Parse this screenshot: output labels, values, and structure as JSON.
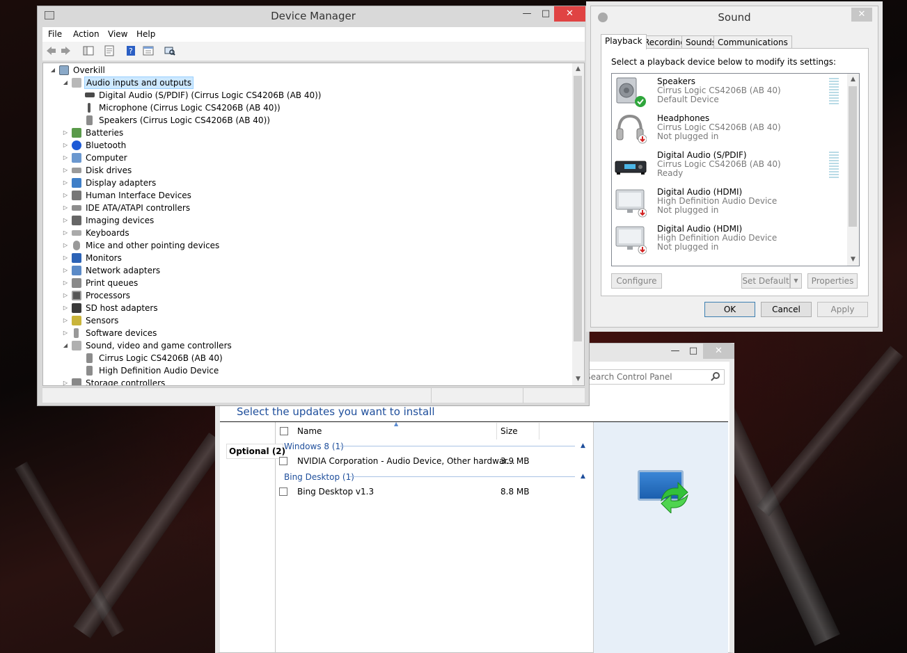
{
  "device_manager": {
    "title": "Device Manager",
    "menu": [
      "File",
      "Action",
      "View",
      "Help"
    ],
    "tree": [
      {
        "label": "Overkill",
        "level": 0,
        "expanded": true
      },
      {
        "label": "Audio inputs and outputs",
        "level": 1,
        "expanded": true,
        "selected": true
      },
      {
        "label": "Digital Audio (S/PDIF) (Cirrus Logic CS4206B (AB 40))",
        "level": 2
      },
      {
        "label": "Microphone (Cirrus Logic CS4206B (AB 40))",
        "level": 2
      },
      {
        "label": "Speakers (Cirrus Logic CS4206B (AB 40))",
        "level": 2
      },
      {
        "label": "Batteries",
        "level": 1,
        "expanded": false
      },
      {
        "label": "Bluetooth",
        "level": 1,
        "expanded": false
      },
      {
        "label": "Computer",
        "level": 1,
        "expanded": false
      },
      {
        "label": "Disk drives",
        "level": 1,
        "expanded": false
      },
      {
        "label": "Display adapters",
        "level": 1,
        "expanded": false
      },
      {
        "label": "Human Interface Devices",
        "level": 1,
        "expanded": false
      },
      {
        "label": "IDE ATA/ATAPI controllers",
        "level": 1,
        "expanded": false
      },
      {
        "label": "Imaging devices",
        "level": 1,
        "expanded": false
      },
      {
        "label": "Keyboards",
        "level": 1,
        "expanded": false
      },
      {
        "label": "Mice and other pointing devices",
        "level": 1,
        "expanded": false
      },
      {
        "label": "Monitors",
        "level": 1,
        "expanded": false
      },
      {
        "label": "Network adapters",
        "level": 1,
        "expanded": false
      },
      {
        "label": "Print queues",
        "level": 1,
        "expanded": false
      },
      {
        "label": "Processors",
        "level": 1,
        "expanded": false
      },
      {
        "label": "SD host adapters",
        "level": 1,
        "expanded": false
      },
      {
        "label": "Sensors",
        "level": 1,
        "expanded": false
      },
      {
        "label": "Software devices",
        "level": 1,
        "expanded": false
      },
      {
        "label": "Sound, video and game controllers",
        "level": 1,
        "expanded": true
      },
      {
        "label": "Cirrus Logic CS4206B (AB 40)",
        "level": 2
      },
      {
        "label": "High Definition Audio Device",
        "level": 2
      },
      {
        "label": "Storage controllers",
        "level": 1,
        "expanded": false
      }
    ]
  },
  "sound": {
    "title": "Sound",
    "tabs": [
      "Playback",
      "Recording",
      "Sounds",
      "Communications"
    ],
    "active_tab": "Playback",
    "prompt": "Select a playback device below to modify its settings:",
    "devices": [
      {
        "name": "Speakers",
        "driver": "Cirrus Logic CS4206B (AB 40)",
        "status": "Default Device",
        "icon": "speaker-icon",
        "badge": "default",
        "meter": true
      },
      {
        "name": "Headphones",
        "driver": "Cirrus Logic CS4206B (AB 40)",
        "status": "Not plugged in",
        "icon": "headphones-icon",
        "badge": "unplugged",
        "meter": false
      },
      {
        "name": "Digital Audio (S/PDIF)",
        "driver": "Cirrus Logic CS4206B (AB 40)",
        "status": "Ready",
        "icon": "receiver-icon",
        "badge": "none",
        "meter": true
      },
      {
        "name": "Digital Audio (HDMI)",
        "driver": "High Definition Audio Device",
        "status": "Not plugged in",
        "icon": "monitor-icon",
        "badge": "unplugged",
        "meter": false
      },
      {
        "name": "Digital Audio (HDMI)",
        "driver": "High Definition Audio Device",
        "status": "Not plugged in",
        "icon": "monitor-icon",
        "badge": "unplugged",
        "meter": false
      }
    ],
    "buttons": {
      "configure": "Configure",
      "set_default": "Set Default",
      "properties": "Properties",
      "ok": "OK",
      "cancel": "Cancel",
      "apply": "Apply"
    }
  },
  "windows_update": {
    "search_placeholder": "Search Control Panel",
    "heading": "Select the updates you want to install",
    "optional_tab": "Optional (2)",
    "columns": {
      "name": "Name",
      "size": "Size"
    },
    "groups": [
      {
        "label": "Windows 8 (1)",
        "items": [
          {
            "name": "NVIDIA Corporation - Audio Device, Other hardwar...",
            "size": "3.9 MB"
          }
        ]
      },
      {
        "label": "Bing Desktop (1)",
        "items": [
          {
            "name": "Bing Desktop v1.3",
            "size": "8.8 MB"
          }
        ]
      }
    ]
  },
  "colors": {
    "accent": "#1e4e9b",
    "selection": "#cde8ff",
    "close": "#c7c7c7"
  }
}
